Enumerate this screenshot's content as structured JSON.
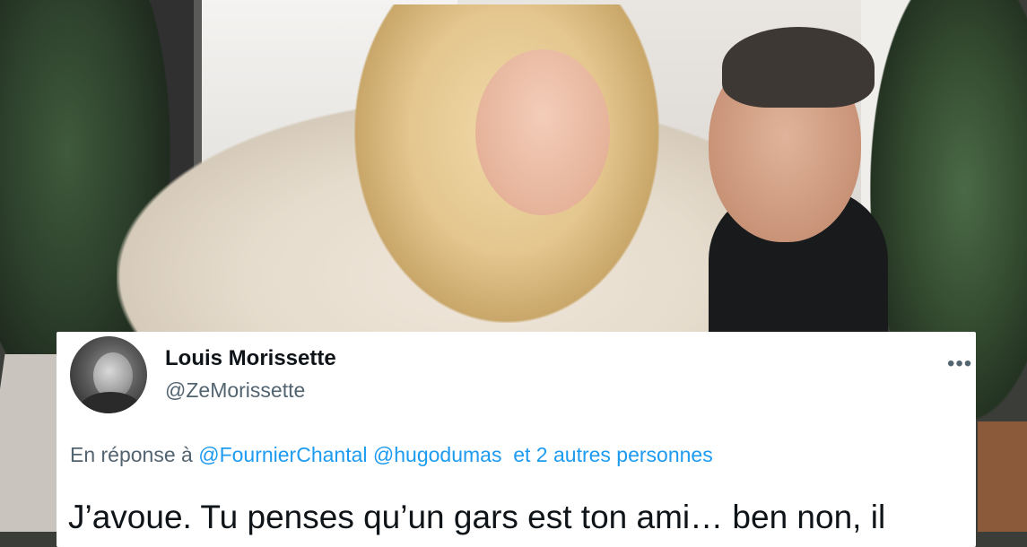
{
  "tweet": {
    "display_name": "Louis Morissette",
    "handle": "@ZeMorissette",
    "more_icon": "•••",
    "reply_prefix": "En réponse à",
    "mention_1": "@FournierChantal",
    "mention_2": "@hugodumas",
    "mention_3": "et 2 autres personnes",
    "text": "J’avoue. Tu penses qu’un gars est ton ami… ben non, il"
  },
  "colors": {
    "name": "#0f1419",
    "secondary": "#536471",
    "link": "#1d9bf0",
    "card_bg": "#ffffff"
  }
}
